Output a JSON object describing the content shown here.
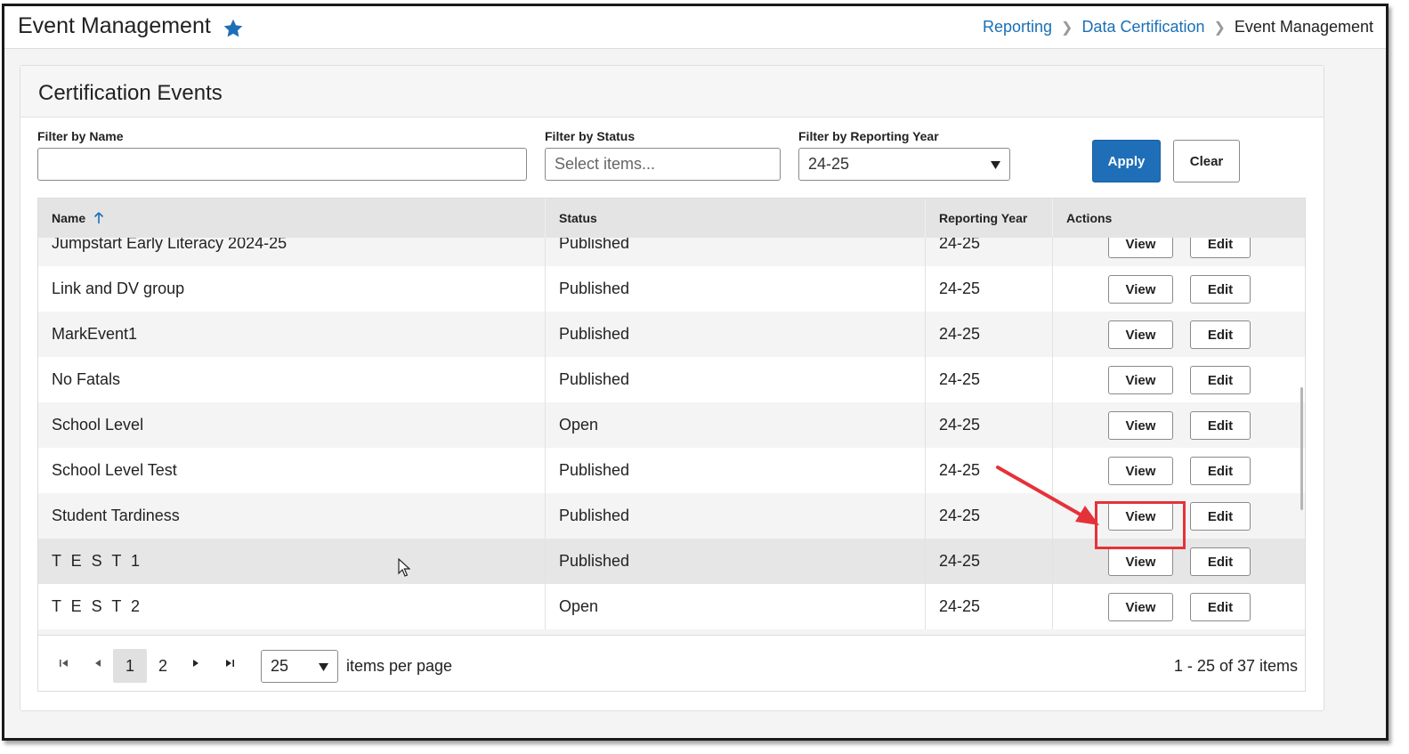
{
  "header": {
    "title": "Event Management",
    "favorite_icon": "star-icon",
    "breadcrumb": [
      "Reporting",
      "Data Certification",
      "Event Management"
    ]
  },
  "card": {
    "title": "Certification Events"
  },
  "filters": {
    "name_label": "Filter by Name",
    "name_value": "",
    "status_label": "Filter by Status",
    "status_placeholder": "Select items...",
    "year_label": "Filter by Reporting Year",
    "year_value": "24-25",
    "apply_label": "Apply",
    "clear_label": "Clear"
  },
  "grid": {
    "columns": [
      "Name",
      "Status",
      "Reporting Year",
      "Actions"
    ],
    "sort": {
      "column": "Name",
      "direction": "ascending"
    },
    "view_label": "View",
    "edit_label": "Edit",
    "rows": [
      {
        "name": "Jumpstart Early Literacy 2024-25",
        "status": "Published",
        "year": "24-25"
      },
      {
        "name": "Link and DV group",
        "status": "Published",
        "year": "24-25"
      },
      {
        "name": "MarkEvent1",
        "status": "Published",
        "year": "24-25"
      },
      {
        "name": "No Fatals",
        "status": "Published",
        "year": "24-25"
      },
      {
        "name": "School Level",
        "status": "Open",
        "year": "24-25"
      },
      {
        "name": "School Level Test",
        "status": "Published",
        "year": "24-25"
      },
      {
        "name": "Student Tardiness",
        "status": "Published",
        "year": "24-25"
      },
      {
        "name": "T E S T 1",
        "status": "Published",
        "year": "24-25"
      },
      {
        "name": "T E S T 2",
        "status": "Open",
        "year": "24-25"
      }
    ]
  },
  "pager": {
    "pages": [
      "1",
      "2"
    ],
    "current_page": "1",
    "page_size": "25",
    "items_per_page_label": "items per page",
    "info": "1 - 25 of 37 items"
  },
  "colors": {
    "primary": "#1f6fb8",
    "link": "#1a6fb5",
    "annotation": "#e53238",
    "header_bg": "#e4e4e4",
    "alt_row": "#f4f4f4"
  }
}
